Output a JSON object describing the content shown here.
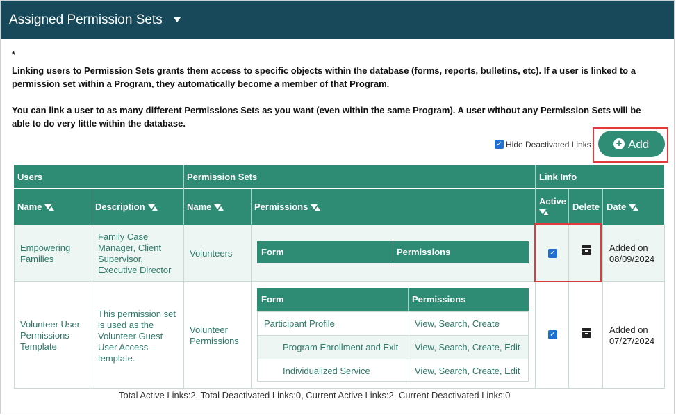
{
  "header": {
    "title": "Assigned Permission Sets"
  },
  "intro": {
    "star": "*",
    "paragraph1": "Linking users to Permission Sets grants them access to specific objects within the database (forms, reports, bulletins, etc). If a user is linked to a permission set within a Program, they automatically become a member of that Program.",
    "paragraph2": "You can link a user to as many different Permissions Sets as you want (even within the same Program). A user without any Permission Sets will be able to do very little within the database."
  },
  "controls": {
    "hide_deactivated_label": "Hide Deactivated Links",
    "add_label": "Add"
  },
  "table": {
    "groups": {
      "users": "Users",
      "permission_sets": "Permission Sets",
      "link_info": "Link Info"
    },
    "columns": {
      "name": "Name",
      "description": "Description",
      "ps_name": "Name",
      "permissions": "Permissions",
      "active": "Active",
      "delete": "Delete",
      "date": "Date"
    },
    "rows": [
      {
        "user": "Empowering Families",
        "description": "Family Case Manager, Client Supervisor, Executive Director",
        "ps_name": "Volunteers",
        "inner_header": {
          "form": "Form",
          "permissions": "Permissions"
        },
        "inner_rows": [],
        "active": true,
        "date": "Added on 08/09/2024"
      },
      {
        "user": "Volunteer User Permissions Template",
        "description": "This permission set is used as the Volunteer Guest User Access template.",
        "ps_name": "Volunteer Permissions",
        "inner_header": {
          "form": "Form",
          "permissions": "Permissions"
        },
        "inner_rows": [
          {
            "form": "Participant Profile",
            "permissions": "View, Search, Create"
          },
          {
            "form": "Program Enrollment and Exit",
            "permissions": "View, Search, Create, Edit"
          },
          {
            "form": "Individualized Service",
            "permissions": "View, Search, Create, Edit"
          }
        ],
        "active": true,
        "date": "Added on 07/27/2024"
      }
    ]
  },
  "totals": "Total Active Links:2, Total Deactivated Links:0, Current Active Links:2, Current Deactivated Links:0",
  "colors": {
    "header_bg": "#17495a",
    "table_header": "#2e8b74",
    "row_highlight": "#eef6f4",
    "link_text": "#2c7a68",
    "highlight_box": "#e03b3b"
  }
}
